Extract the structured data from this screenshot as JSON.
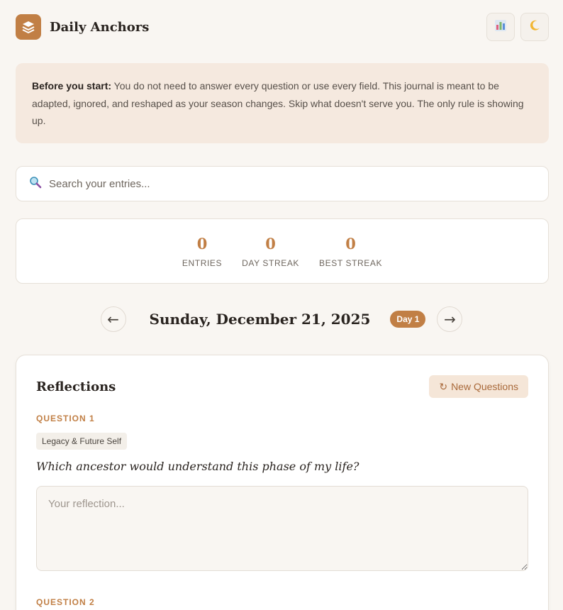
{
  "app": {
    "title": "Daily Anchors",
    "actions": [
      {
        "name": "stats",
        "icon": "bar-chart-icon"
      },
      {
        "name": "theme",
        "icon": "moon-icon"
      }
    ]
  },
  "notice": {
    "lead": "Before you start:",
    "text": " You do not need to answer every question or use every field. This journal is meant to be adapted, ignored, and reshaped as your season changes. Skip what doesn't serve you. The only rule is showing up."
  },
  "search": {
    "placeholder": "Search your entries...",
    "value": "",
    "icon": "magnifier-icon"
  },
  "stats": [
    {
      "value": "0",
      "label": "Entries"
    },
    {
      "value": "0",
      "label": "Day Streak"
    },
    {
      "value": "0",
      "label": "Best Streak"
    }
  ],
  "date_nav": {
    "prev": "←",
    "date": "Sunday, December 21, 2025",
    "day_badge": "Day 1",
    "next": "→"
  },
  "reflections": {
    "title": "Reflections",
    "new_questions": "New Questions",
    "new_questions_icon": "↻",
    "questions": [
      {
        "label": "QUESTION 1",
        "category": "Legacy & Future Self",
        "text": "Which ancestor would understand this phase of my life?",
        "placeholder": "Your reflection..."
      },
      {
        "label": "QUESTION 2"
      }
    ]
  },
  "colors": {
    "accent": "#c17f45",
    "background": "#f9f6f2",
    "notice_bg": "#f5e9df"
  }
}
